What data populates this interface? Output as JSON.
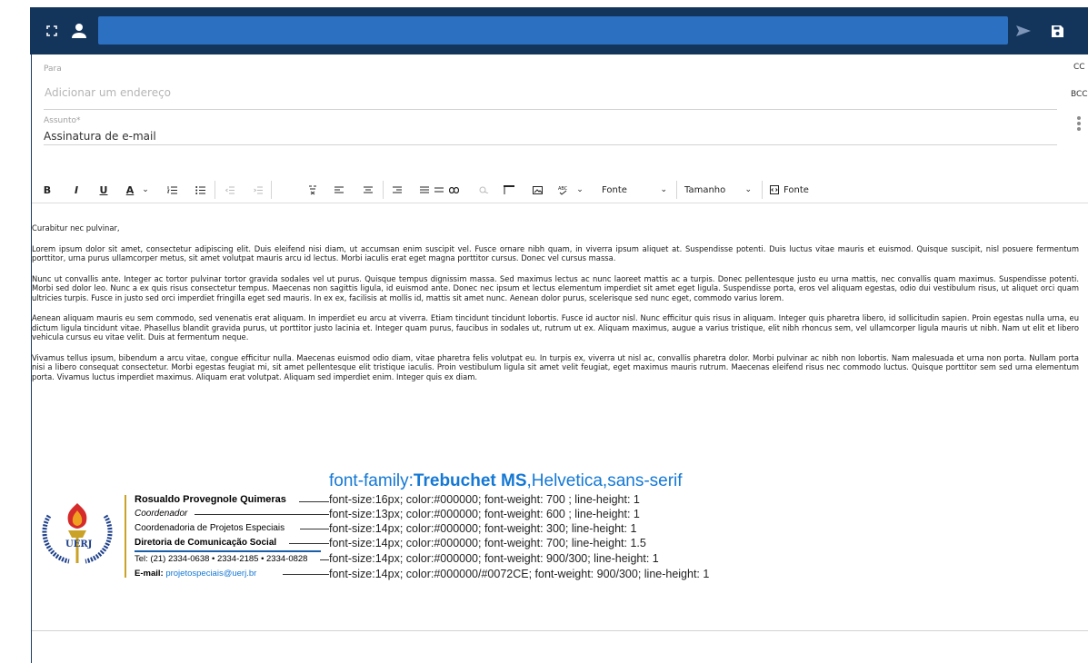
{
  "colors": {
    "topbar": "#13355c",
    "field": "#2c70c2",
    "signature_accent": "#1478d4",
    "gold": "#c9a227"
  },
  "topbar": {
    "expand_icon": "expand-icon",
    "user_icon": "user-icon",
    "send_icon": "send-icon",
    "save_icon": "save-icon"
  },
  "to": {
    "label": "Para",
    "placeholder": "Adicionar um endereço"
  },
  "subject": {
    "label": "Assunto*",
    "value": "Assinatura de e-mail"
  },
  "side": {
    "cc": "CC",
    "bcc": "BCC"
  },
  "toolbar": {
    "bold": "B",
    "italic": "I",
    "underline": "U",
    "color": "A",
    "font_label": "Fonte",
    "size_label": "Tamanho",
    "source_label": "Fonte"
  },
  "body": {
    "greeting": "Curabitur nec pulvinar,",
    "paragraphs": [
      "Lorem ipsum dolor sit amet, consectetur adipiscing elit. Duis eleifend nisi diam, ut accumsan enim suscipit vel. Fusce ornare nibh quam, in viverra ipsum aliquet at. Suspendisse potenti. Duis luctus vitae mauris et euismod. Quisque suscipit, nisl posuere fermentum porttitor, urna purus ullamcorper metus, sit amet volutpat mauris arcu id lectus. Morbi iaculis erat eget magna porttitor cursus. Donec vel cursus massa.",
      "Nunc ut convallis ante. Integer ac tortor pulvinar tortor gravida sodales vel ut purus. Quisque tempus dignissim massa. Sed maximus lectus ac nunc laoreet mattis ac a turpis. Donec pellentesque justo eu urna mattis, nec convallis quam maximus. Suspendisse potenti. Morbi sed dolor leo. Nunc a ex quis risus consectetur tempus. Maecenas non sagittis ligula, id euismod ante. Donec nec ipsum et lectus elementum imperdiet sit amet eget ligula. Suspendisse porta, eros vel aliquam egestas, odio dui vestibulum risus, ut aliquet orci quam ultricies turpis. Fusce in justo sed orci imperdiet fringilla eget sed mauris. In ex ex, facilisis at mollis id, mattis sit amet nunc. Aenean dolor purus, scelerisque sed nunc eget, commodo varius lorem.",
      "Aenean aliquam mauris eu sem commodo, sed venenatis erat aliquam. In imperdiet eu arcu at viverra. Etiam tincidunt tincidunt lobortis. Fusce id auctor nisl. Nunc efficitur quis risus in aliquam. Integer quis pharetra libero, id sollicitudin sapien. Proin egestas nulla urna, eu dictum ligula tincidunt vitae. Phasellus blandit gravida purus, ut porttitor justo lacinia et. Integer quam purus, faucibus in sodales ut, rutrum ut ex. Aliquam maximus, augue a varius tristique, elit nibh rhoncus sem, vel ullamcorper ligula mauris ut nibh. Nam ut elit et libero vehicula cursus eu vitae velit. Duis at fermentum neque.",
      "Vivamus tellus ipsum, bibendum a arcu vitae, congue efficitur nulla. Maecenas euismod odio diam, vitae pharetra felis volutpat eu. In turpis ex, viverra ut nisl ac, convallis pharetra dolor. Morbi pulvinar ac nibh non lobortis. Nam malesuada et urna non porta. Nullam porta nisi a libero consequat consectetur. Morbi egestas feugiat mi, sit amet pellentesque elit tristique iaculis. Proin vestibulum ligula sit amet velit feugiat, eget maximus mauris rutrum. Maecenas eleifend risus nec commodo luctus. Quisque porttitor sem sed urna elementum porta. Vivamus luctus imperdiet maximus. Aliquam erat volutpat. Aliquam sed imperdiet enim. Integer quis ex diam."
    ]
  },
  "signature": {
    "font_prefix": "font-family:",
    "font_bold": "Trebuchet MS",
    "font_suffix": ",Helvetica,sans-serif",
    "logo_text": "UERJ",
    "logo_ring_text": "UNIVERSIDADE DO ESTADO DO RIO DE JANEIRO",
    "name": "Rosualdo Provegnole Quimeras",
    "role": "Coordenador",
    "department": "Coordenadoria  de Projetos Especiais",
    "division": "Diretoria de Comunicação Social",
    "tel": "Tel: (21) 2334-0638 • 2334-2185 • 2334-0828",
    "email_label": "E-mail:",
    "email": "projetospeciais@uerj.br",
    "notes": [
      "font-size:16px; color:#000000; font-weight: 700 ; line-height: 1",
      "font-size:13px; color:#000000; font-weight: 600 ; line-height: 1",
      "font-size:14px; color:#000000; font-weight: 300; line-height: 1",
      "font-size:14px; color:#000000; font-weight: 700; line-height: 1.5",
      "font-size:14px; color:#000000; font-weight: 900/300; line-height: 1",
      "font-size:14px; color:#000000/#0072CE; font-weight: 900/300; line-height: 1"
    ]
  }
}
